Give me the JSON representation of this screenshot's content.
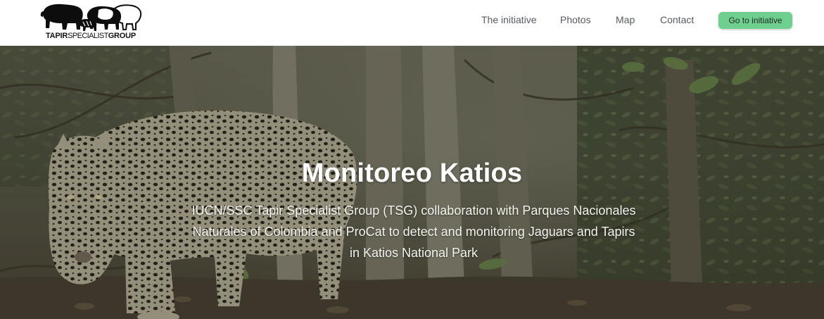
{
  "header": {
    "logo": {
      "text_bold_left": "TAPIR",
      "text_thin": "SPECIALIST",
      "text_bold_right": "GROUP",
      "icon": "tapir-family-logo-icon"
    },
    "nav": [
      {
        "label": "The initiative"
      },
      {
        "label": "Photos"
      },
      {
        "label": "Map"
      },
      {
        "label": "Contact"
      }
    ],
    "cta_label": "Go to initiative"
  },
  "hero": {
    "image": "jaguar-camera-trap-photo",
    "title": "Monitoreo Katios",
    "subtitle": "IUCN/SSC Tapir Specialist Group (TSG) collaboration with Parques Nacionales Naturales of Colombia and ProCat to detect and monitoring Jaguars and Tapirs in Katios National Park"
  },
  "colors": {
    "cta_background": "#6fcf8f",
    "nav_text": "#555c63",
    "header_background": "#ffffff"
  }
}
